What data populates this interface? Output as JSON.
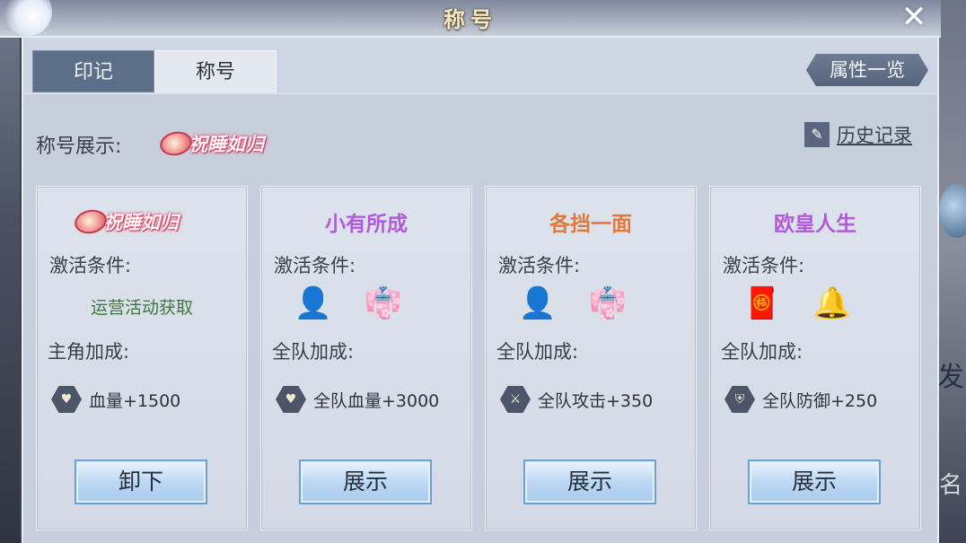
{
  "window": {
    "title": "称号",
    "close_icon": "close-icon"
  },
  "tabs": [
    {
      "label": "印记",
      "active": false
    },
    {
      "label": "称号",
      "active": true
    }
  ],
  "attributes_button": "属性一览",
  "showcase": {
    "label": "称号展示:",
    "current_badge": "祝睡如归"
  },
  "history_link": "历史记录",
  "cards": [
    {
      "name": "祝睡如归",
      "name_style": "badge",
      "condition_label": "激活条件:",
      "condition_text": "运营活动获取",
      "items": [],
      "bonus_label": "主角加成:",
      "stat_icon": "heart-icon",
      "stat": "血量+1500",
      "action": "卸下"
    },
    {
      "name": "小有所成",
      "name_color": "#b25ad8",
      "condition_label": "激活条件:",
      "condition_text": "",
      "items": [
        {
          "icon": "hero-figure-icon",
          "glyph": "👤"
        },
        {
          "icon": "golden-robe-icon",
          "glyph": "👘"
        }
      ],
      "bonus_label": "全队加成:",
      "stat_icon": "heart-icon",
      "stat": "全队血量+3000",
      "action": "展示"
    },
    {
      "name": "各挡一面",
      "name_color": "#e07a3c",
      "condition_label": "激活条件:",
      "condition_text": "",
      "items": [
        {
          "icon": "hero-figure-icon",
          "glyph": "👤"
        },
        {
          "icon": "pink-robe-icon",
          "glyph": "👘"
        }
      ],
      "bonus_label": "全队加成:",
      "stat_icon": "sword-icon",
      "stat": "全队攻击+350",
      "action": "展示"
    },
    {
      "name": "欧皇人生",
      "name_color": "#b25ad8",
      "condition_label": "激活条件:",
      "condition_text": "",
      "items": [
        {
          "icon": "red-envelope-icon",
          "glyph": "🧧"
        },
        {
          "icon": "bell-icon",
          "glyph": "🔔"
        }
      ],
      "bonus_label": "全队加成:",
      "stat_icon": "shield-icon",
      "stat": "全队防御+250",
      "action": "展示"
    }
  ]
}
